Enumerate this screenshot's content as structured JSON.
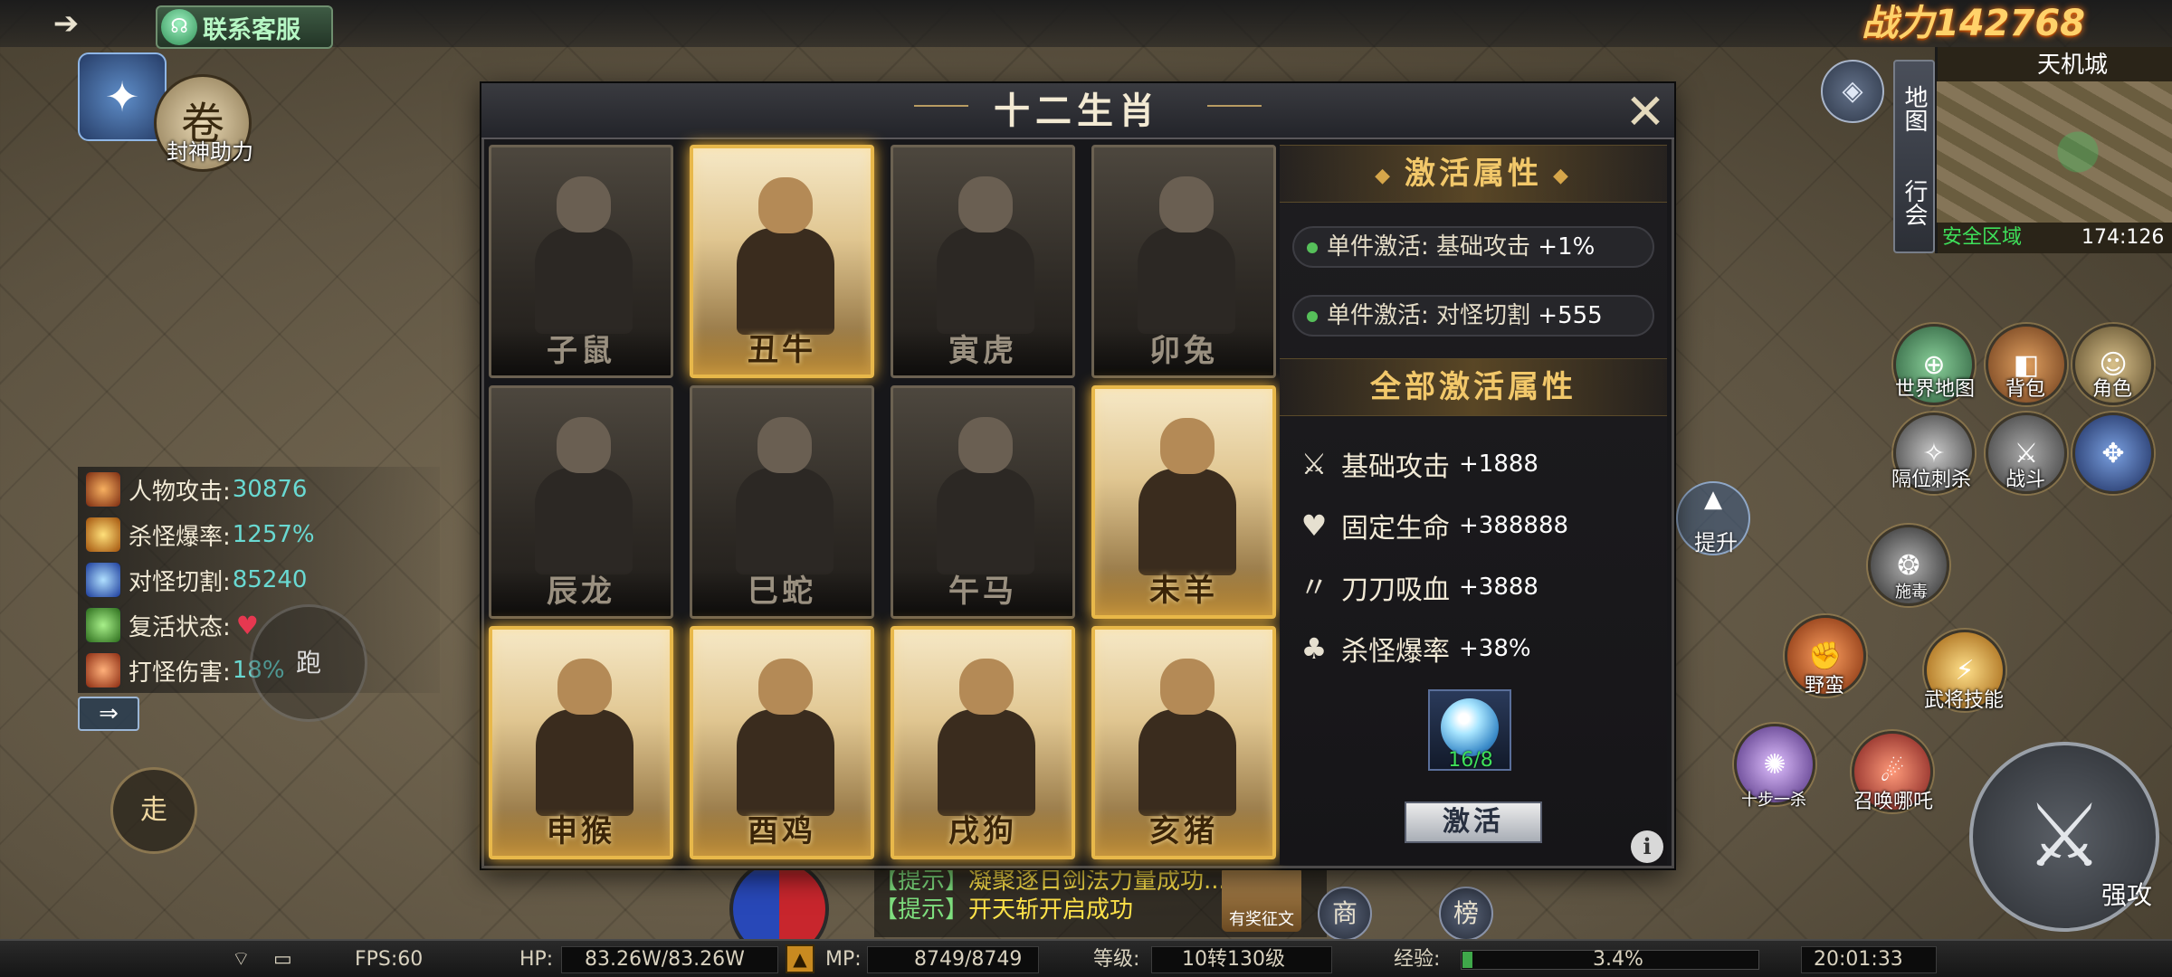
{
  "hud": {
    "back_icon": "arrow-right-icon",
    "customer_service": "联系客服",
    "power_label": "战力",
    "power_value": "142768",
    "fengshen_label": "封神助力",
    "minimap": {
      "title": "天机城",
      "safe_zone": "安全区域",
      "coords": "174:126",
      "tab_map": "地图",
      "tab_guild": "行会"
    },
    "run": "跑",
    "walk": "走",
    "lift": "提升",
    "right_buttons": [
      {
        "label": "世界地图"
      },
      {
        "label": "背包"
      },
      {
        "label": "角色"
      },
      {
        "label": "隔位刺杀"
      },
      {
        "label": "战斗"
      },
      {
        "label": "施毒"
      },
      {
        "label": "野蛮"
      },
      {
        "label": "武将技能"
      },
      {
        "label": "十步一杀"
      },
      {
        "label": "召唤哪吒"
      }
    ],
    "strong_attack": "强攻",
    "shop": "商",
    "rank": "榜"
  },
  "left_stats": [
    {
      "label": "人物攻击:",
      "value": "30876",
      "color": "#e07a2a"
    },
    {
      "label": "杀怪爆率:",
      "value": "1257%",
      "color": "#e8a030"
    },
    {
      "label": "对怪切割:",
      "value": "85240",
      "color": "#3a6ad8"
    },
    {
      "label": "复活状态:",
      "value": "",
      "color": "#48a83a"
    },
    {
      "label": "打怪伤害:",
      "value": "18%",
      "color": "#c84a2a"
    }
  ],
  "chat": [
    {
      "tag": "【提示】",
      "text": "凝聚逐日剑法力量成功..."
    },
    {
      "tag": "【提示】",
      "text": "开天斩开启成功"
    }
  ],
  "chat_gift": "有奖征文",
  "status_bar": {
    "fps": "FPS:60",
    "hp_label": "HP:",
    "hp_value": "83.26W/83.26W",
    "mp_label": "MP:",
    "mp_value": "8749/8749",
    "level_label": "等级:",
    "level_value": "10转130级",
    "exp_label": "经验:",
    "exp_value": "3.4%",
    "exp_progress": 0.034,
    "time": "20:01:33"
  },
  "panel": {
    "title": "十二生肖",
    "cards": [
      {
        "name": "子鼠",
        "active": false
      },
      {
        "name": "丑牛",
        "active": true
      },
      {
        "name": "寅虎",
        "active": false
      },
      {
        "name": "卯兔",
        "active": false
      },
      {
        "name": "辰龙",
        "active": false
      },
      {
        "name": "巳蛇",
        "active": false
      },
      {
        "name": "午马",
        "active": false
      },
      {
        "name": "未羊",
        "active": true
      },
      {
        "name": "申猴",
        "active": true
      },
      {
        "name": "酉鸡",
        "active": true
      },
      {
        "name": "戌狗",
        "active": true
      },
      {
        "name": "亥猪",
        "active": true
      }
    ],
    "activation_title": "激活属性",
    "single_attrs": [
      {
        "label": "单件激活: 基础攻击",
        "value": "+1%"
      },
      {
        "label": "单件激活: 对怪切割",
        "value": "+555"
      }
    ],
    "all_title": "全部激活属性",
    "all_attrs": [
      {
        "icon": "crossed-swords-icon",
        "label": "基础攻击",
        "value": "+1888"
      },
      {
        "icon": "heart-icon",
        "label": "固定生命",
        "value": "+388888"
      },
      {
        "icon": "blade-drain-icon",
        "label": "刀刀吸血",
        "value": "+3888"
      },
      {
        "icon": "clover-icon",
        "label": "杀怪爆率",
        "value": "+38%"
      }
    ],
    "gem_count": "16/8",
    "activate_button": "激活"
  }
}
